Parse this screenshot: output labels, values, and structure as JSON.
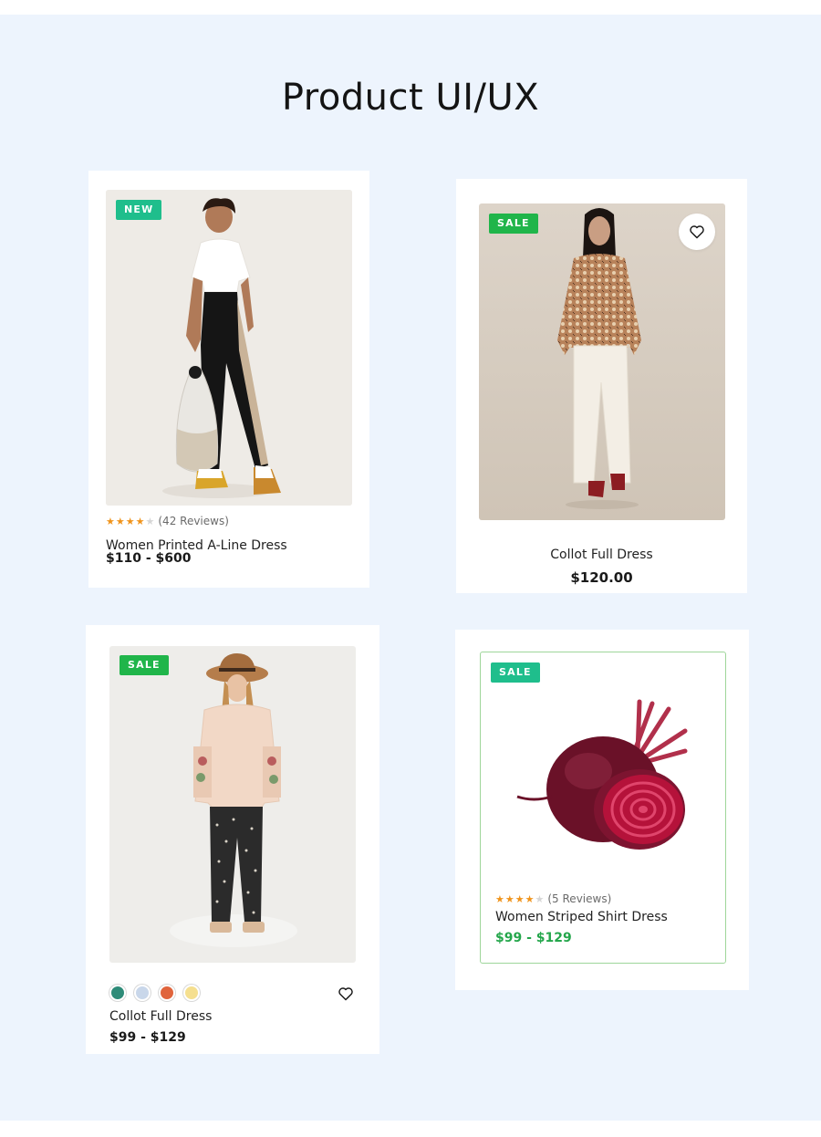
{
  "page": {
    "title": "Product UI/UX"
  },
  "products": [
    {
      "badge": "NEW",
      "rating": 4,
      "reviews": "(42 Reviews)",
      "name": "Women Printed A-Line Dress",
      "price": "$110 - $600"
    },
    {
      "badge": "SALE",
      "name": "Collot Full Dress",
      "price": "$120.00",
      "wishlist_icon": "heart-icon"
    },
    {
      "badge": "SALE",
      "swatches": [
        "#2e8b78",
        "#c9d7ea",
        "#e0643c",
        "#f5df8f"
      ],
      "name": "Collot Full Dress",
      "price": "$99 - $129",
      "wishlist_icon": "heart-icon"
    },
    {
      "badge": "SALE",
      "rating": 4,
      "reviews": "(5 Reviews)",
      "name": "Women Striped Shirt Dress",
      "price": "$99 - $129"
    }
  ],
  "colors": {
    "background": "#edf4fd",
    "badge_new": "#1fbe8c",
    "badge_sale": "#20b54a",
    "star": "#f0941c",
    "price_green": "#24a64b",
    "card_border_green": "#9ed69a"
  }
}
